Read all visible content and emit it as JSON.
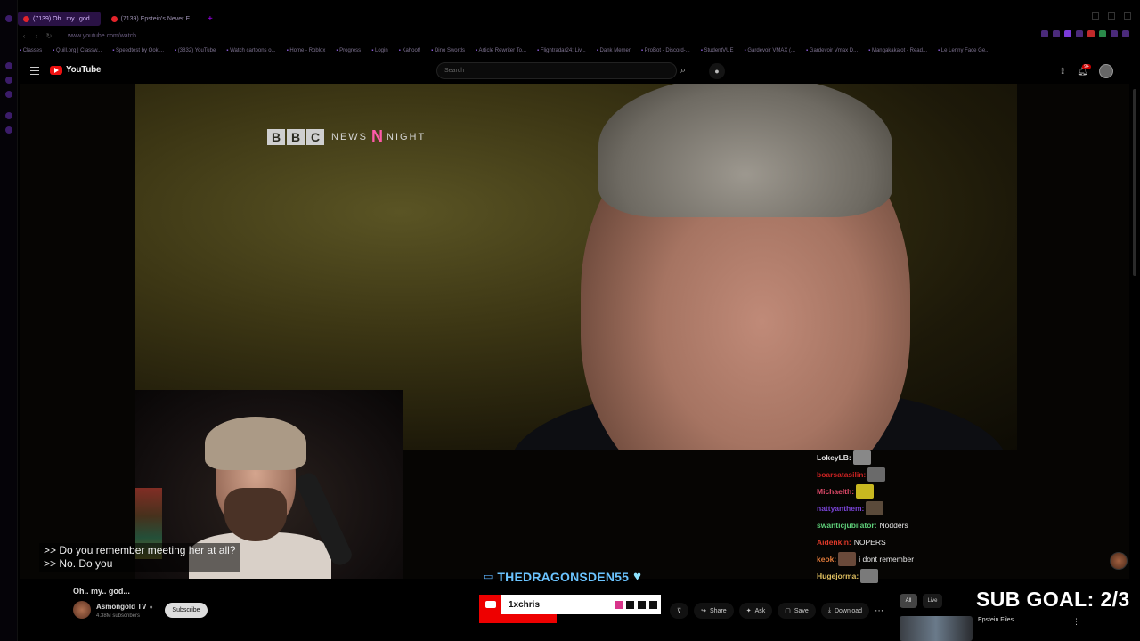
{
  "browser": {
    "tabs": [
      {
        "label": "(7139) Oh.. my.. god...",
        "active": true
      },
      {
        "label": "(7139) Epstein's Never E...",
        "active": false
      }
    ],
    "new_tab_label": "+",
    "url": "www.youtube.com/watch",
    "bookmarks": [
      "Classes",
      "Quill.org | Classw...",
      "Speedtest by Ookl...",
      "(3832) YouTube",
      "Watch cartoons o...",
      "Home - Roblox",
      "Progress",
      "Login",
      "Kahoot!",
      "Dino Swords",
      "Article Rewriter To...",
      "Flightradar24: Liv...",
      "Dank Memer",
      "ProBot - Discord-...",
      "StudentVUE",
      "Gardevoir VMAX (...",
      "Gardevoir Vmax D...",
      "Mangakakalot - Read...",
      "Le Lenny Face Ge..."
    ],
    "colors": {
      "accent": "#8a2be2",
      "tab_active_bg": "#2a1245"
    }
  },
  "youtube": {
    "logo_text": "YouTube",
    "search_placeholder": "Search",
    "notification_count": "9+"
  },
  "video": {
    "broadcaster_logo": {
      "blocks": [
        "B",
        "B",
        "C"
      ],
      "left_word": "NEWS",
      "mark": "N",
      "right_word": "NIGHT"
    },
    "captions": [
      ">> Do you remember meeting her at all?",
      ">> No. Do you"
    ],
    "streamer_name": "THEDRAGONSDEN55"
  },
  "chat": [
    {
      "user": "LokeyLB:",
      "color": "#e0e0e0",
      "message": "",
      "emote": "#888888"
    },
    {
      "user": "boarsatasilin:",
      "color": "#cc2222",
      "message": "",
      "emote": "#6a6a6a"
    },
    {
      "user": "Michaelth:",
      "color": "#e04a6a",
      "message": "",
      "emote": "#c8b820"
    },
    {
      "user": "nattyanthem:",
      "color": "#7a44d8",
      "message": "",
      "emote": "#5a4a3a"
    },
    {
      "user": "swanticjubilator:",
      "color": "#5fd07a",
      "message": "Nodders",
      "emote": ""
    },
    {
      "user": "Aidenkin:",
      "color": "#e03a2a",
      "message": "NOPERS",
      "emote": ""
    },
    {
      "user": "keok:",
      "color": "#e07a3a",
      "message": "i dont remember",
      "emote": "#6a4a3a"
    },
    {
      "user": "Hugejorma:",
      "color": "#e0c060",
      "message": "",
      "emote": "#7a7a7a"
    }
  ],
  "below_video": {
    "title": "Oh.. my.. god...",
    "channel_name": "Asmongold TV",
    "subscribers": "4.38M subscribers",
    "subscribe_label": "Subscribe",
    "actions": [
      {
        "icon": "dislike-icon",
        "label": ""
      },
      {
        "icon": "share-icon",
        "label": "Share"
      },
      {
        "icon": "ask-icon",
        "label": "Ask"
      },
      {
        "icon": "save-icon",
        "label": "Save"
      },
      {
        "icon": "download-icon",
        "label": "Download"
      }
    ],
    "more_label": "⋯"
  },
  "sub_alert": {
    "username": "1xchris"
  },
  "sub_goal": "SUB GOAL: 2/3",
  "sidebar": {
    "filters": [
      "All",
      "Live"
    ],
    "recommended_title": "Epstein Files"
  }
}
